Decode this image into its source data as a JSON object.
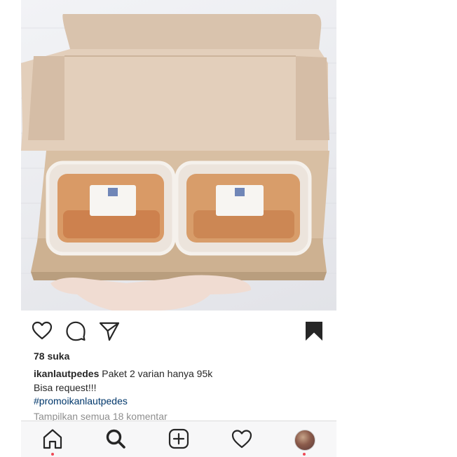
{
  "post": {
    "image_alt": "Box with two containers of spicy seafood",
    "likes_text": "78 suka",
    "caption": {
      "username": "ikanlautpedes",
      "text": "Paket 2 varian hanya 95k",
      "line2": "Bisa request!!!",
      "hashtag": "#promoikanlautpedes"
    },
    "view_comments_text": "Tampilkan semua 18 komentar"
  },
  "icons": {
    "like": "heart-outline-icon",
    "comment": "comment-icon",
    "share": "paper-plane-icon",
    "save": "bookmark-filled-icon"
  },
  "bottom_nav": [
    {
      "name": "home",
      "icon": "home-icon"
    },
    {
      "name": "search",
      "icon": "search-icon"
    },
    {
      "name": "new-post",
      "icon": "plus-square-icon"
    },
    {
      "name": "activity",
      "icon": "heart-icon"
    },
    {
      "name": "profile",
      "icon": "avatar"
    }
  ],
  "colors": {
    "text": "#262626",
    "hashtag": "#00376b",
    "muted": "#8e8e8e",
    "notification_dot": "#ed4956"
  }
}
